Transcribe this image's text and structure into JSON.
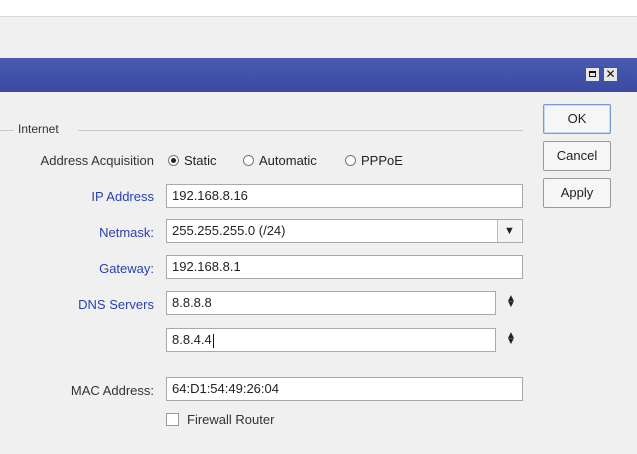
{
  "window": {
    "maximize_icon": "maximize-icon",
    "close_glyph": "✕"
  },
  "internet": {
    "group_label": "Internet",
    "address_acquisition": {
      "label": "Address Acquisition",
      "options": [
        "Static",
        "Automatic",
        "PPPoE"
      ],
      "selected": "Static"
    },
    "ip_address": {
      "label": "IP Address",
      "value": "192.168.8.16"
    },
    "netmask": {
      "label": "Netmask:",
      "value": "255.255.255.0 (/24)",
      "dropdown_glyph": "▼"
    },
    "gateway": {
      "label": "Gateway:",
      "value": "192.168.8.1"
    },
    "dns": {
      "label": "DNS Servers",
      "values": [
        "8.8.8.8",
        "8.8.4.4"
      ]
    },
    "mac": {
      "label": "MAC Address:",
      "value": "64:D1:54:49:26:04"
    },
    "firewall": {
      "label": "Firewall Router",
      "checked": false
    }
  },
  "buttons": {
    "ok": "OK",
    "cancel": "Cancel",
    "apply": "Apply"
  }
}
